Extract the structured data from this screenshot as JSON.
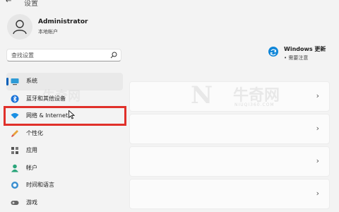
{
  "window": {
    "back_glyph": "←",
    "title": "设置"
  },
  "user": {
    "name": "Administrator",
    "subtitle": "本地帐户"
  },
  "search": {
    "placeholder": "查找设置"
  },
  "sidebar": {
    "items": [
      {
        "label": "系统",
        "icon": "monitor-icon",
        "selected": true
      },
      {
        "label": "蓝牙和其他设备",
        "icon": "bluetooth-icon"
      },
      {
        "label": "网络 & Internet",
        "icon": "wifi-icon"
      },
      {
        "label": "个性化",
        "icon": "brush-icon"
      },
      {
        "label": "应用",
        "icon": "apps-icon"
      },
      {
        "label": "帐户",
        "icon": "person-icon"
      },
      {
        "label": "时间和语言",
        "icon": "globe-icon"
      },
      {
        "label": "游戏",
        "icon": "gamepad-icon"
      }
    ]
  },
  "update": {
    "title": "Windows 更新",
    "subtitle": "• 需要注意"
  },
  "cards": {
    "chevron": "›"
  },
  "watermark": {
    "logo": "N",
    "text": "牛奇网",
    "url": "NIUQI360.COM",
    "side_text": "牛奇网"
  },
  "colors": {
    "accent": "#005fb8",
    "highlight": "#e0302a",
    "update_icon": "#0f86d8"
  }
}
